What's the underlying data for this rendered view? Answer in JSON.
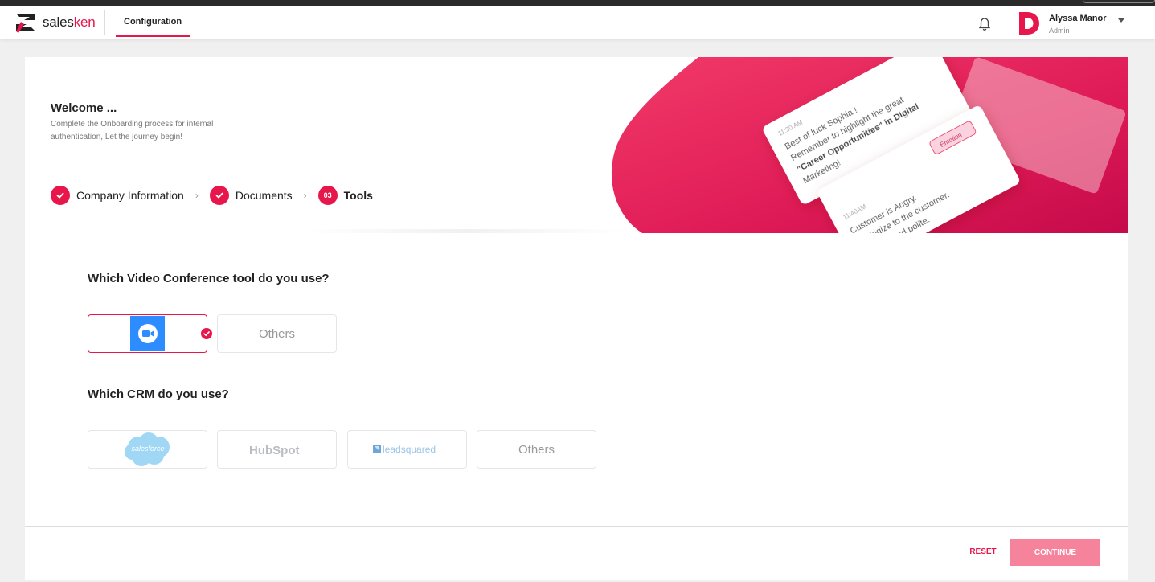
{
  "header": {
    "logo": {
      "part1": "sales",
      "part2": "ken"
    },
    "nav_tab": "Configuration",
    "user": {
      "name": "Alyssa Manor",
      "role": "Admin",
      "initial": "D"
    }
  },
  "welcome": {
    "title": "Welcome ...",
    "subtitle": "Complete the Onboarding process for internal authentication, Let the journey begin!"
  },
  "steps": [
    {
      "label": "Company Information",
      "status": "done"
    },
    {
      "label": "Documents",
      "status": "done"
    },
    {
      "label": "Tools",
      "status": "active",
      "number": "03"
    }
  ],
  "banner_cards": {
    "card1": {
      "time": "11:30 AM",
      "lines": [
        "Best of luck Sophia !",
        "Remember to highlight the great",
        "\"Career Opportunities\" in Digital",
        "Marketing!"
      ]
    },
    "card2": {
      "time": "11:40AM",
      "tag": "Emotion",
      "lines": [
        "Customer is Angry.",
        "Apologize to the customer.",
        "Be calm and polite."
      ]
    }
  },
  "video_section": {
    "title": "Which Video Conference tool do you use?",
    "options": [
      {
        "name": "zoom",
        "selected": true
      },
      {
        "name": "Others",
        "selected": false
      }
    ]
  },
  "crm_section": {
    "title": "Which CRM do you use?",
    "options": [
      {
        "name": "salesforce"
      },
      {
        "name": "HubSpot"
      },
      {
        "name": "leadsquared"
      },
      {
        "name": "Others"
      }
    ]
  },
  "footer": {
    "reset_label": "RESET",
    "continue_label": "CONTINUE"
  },
  "colors": {
    "accent": "#e8174b",
    "continue_bg": "#f6839c",
    "zoom_blue": "#2d8cff",
    "salesforce_blue": "#9fd7f5"
  }
}
